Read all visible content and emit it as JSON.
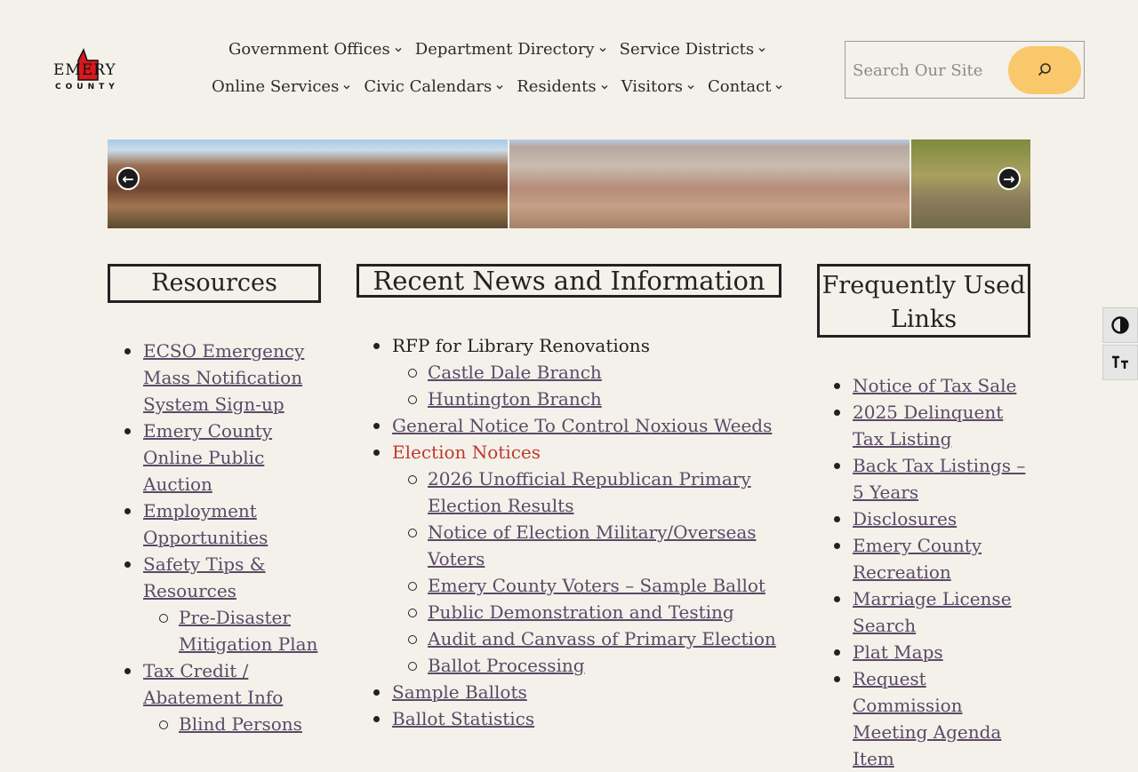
{
  "logo": {
    "line1": "EMERY",
    "line2": "COUNTY"
  },
  "nav": {
    "row1": [
      {
        "label": "Government Offices"
      },
      {
        "label": "Department Directory"
      },
      {
        "label": "Service Districts"
      }
    ],
    "row2": [
      {
        "label": "Online Services"
      },
      {
        "label": "Civic Calendars"
      },
      {
        "label": "Residents"
      },
      {
        "label": "Visitors"
      },
      {
        "label": "Contact"
      }
    ]
  },
  "search": {
    "placeholder": "Search Our Site",
    "button_color": "#f9c86a"
  },
  "slider": {
    "prev_label": "←",
    "next_label": "→"
  },
  "resources": {
    "heading": "Resources",
    "items": [
      {
        "label": "ECSO Emergency Mass Notification System Sign-up"
      },
      {
        "label": "Emery County Online Public Auction"
      },
      {
        "label": "Employment Opportunities"
      },
      {
        "label": "Safety Tips & Resources"
      },
      {
        "label": "Pre-Disaster Mitigation Plan"
      },
      {
        "label": "Tax Credit / Abatement Info"
      },
      {
        "label": "Blind Persons"
      }
    ]
  },
  "news": {
    "heading": "Recent News and Information",
    "items": [
      {
        "label": "RFP for Library Renovations"
      },
      {
        "label": "Castle Dale Branch"
      },
      {
        "label": "Huntington Branch"
      },
      {
        "label": "General Notice To Control Noxious Weeds"
      },
      {
        "label": "Election Notices"
      },
      {
        "label": "2026 Unofficial Republican Primary Election Results"
      },
      {
        "label": "Notice of Election Military/Overseas Voters"
      },
      {
        "label": "Emery County Voters – Sample Ballot"
      },
      {
        "label": "Public Demonstration and Testing"
      },
      {
        "label": "Audit and Canvass of Primary Election"
      },
      {
        "label": "Ballot Processing"
      },
      {
        "label": "Sample Ballots"
      },
      {
        "label": "Ballot Statistics"
      }
    ]
  },
  "frequent": {
    "heading": "Frequently Used Links",
    "items": [
      {
        "label": "Notice of Tax Sale"
      },
      {
        "label": "2025 Delinquent Tax Listing"
      },
      {
        "label": "Back Tax Listings – 5 Years"
      },
      {
        "label": "Disclosures"
      },
      {
        "label": "Emery County Recreation"
      },
      {
        "label": "Marriage License Search"
      },
      {
        "label": "Plat Maps"
      },
      {
        "label": "Request Commission Meeting Agenda Item"
      }
    ]
  },
  "colors": {
    "background": "#f4f1eb",
    "link": "#5b4a66",
    "alert": "#c0392b",
    "logo_red": "#d7191c"
  }
}
